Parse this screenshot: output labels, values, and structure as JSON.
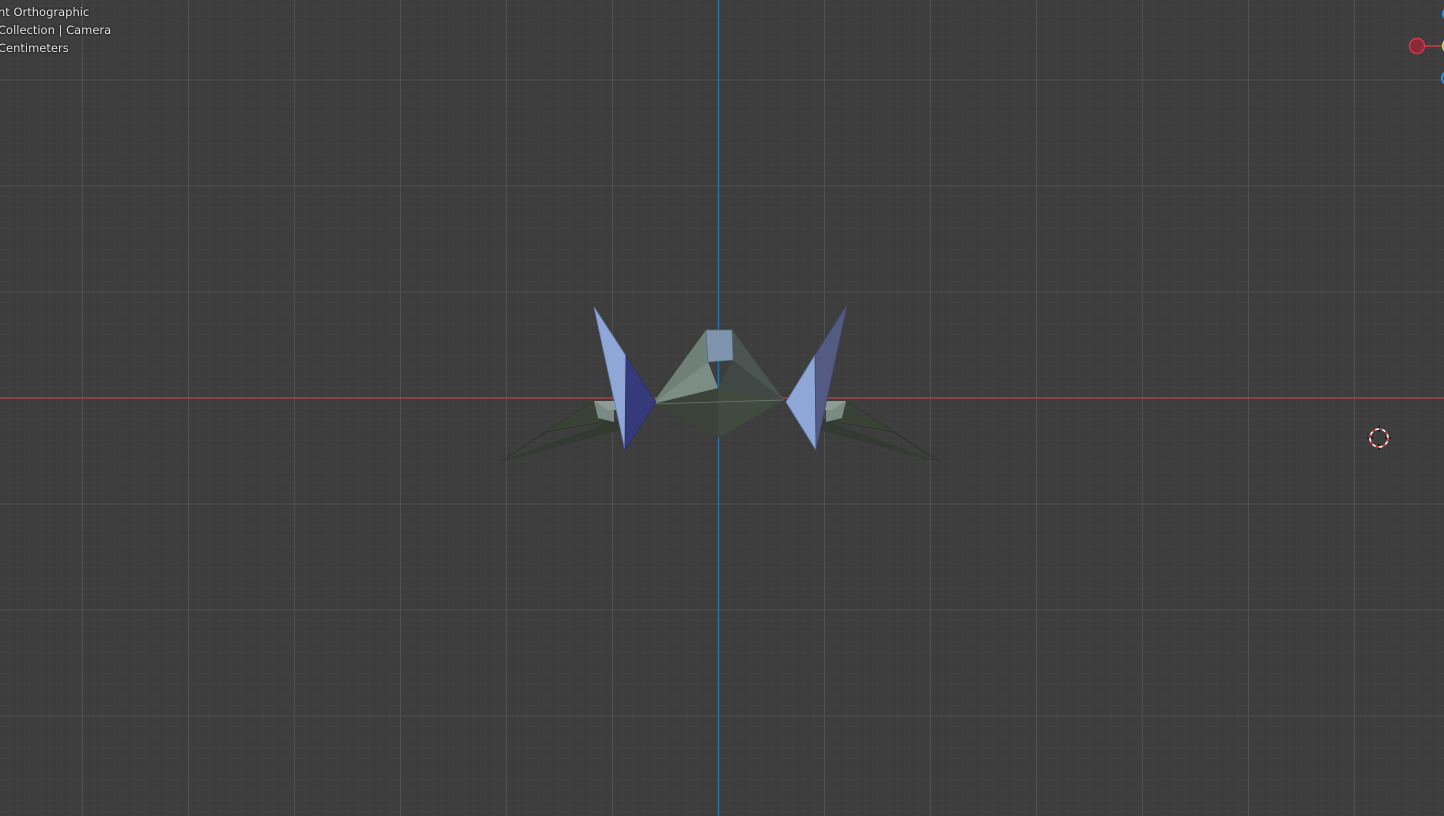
{
  "viewport": {
    "view_name": "nt Orthographic",
    "collection_line": "Collection | Camera",
    "units_line": "Centimeters"
  },
  "colors": {
    "background": "#3d3d3d",
    "grid_minor": "#444444",
    "grid_major": "#4f4f4f",
    "x_axis": "#b8414a",
    "z_axis": "#2c6fad",
    "gizmo_x": "#d4384a",
    "gizmo_y": "#8bc34a",
    "gizmo_z": "#2d8ce0"
  },
  "gizmo": {
    "axes": [
      "x-axis-ball",
      "y-axis-ball",
      "z-axis-ball"
    ]
  },
  "scene": {
    "object": "arwing-model",
    "cursor": "3d-cursor-icon"
  }
}
